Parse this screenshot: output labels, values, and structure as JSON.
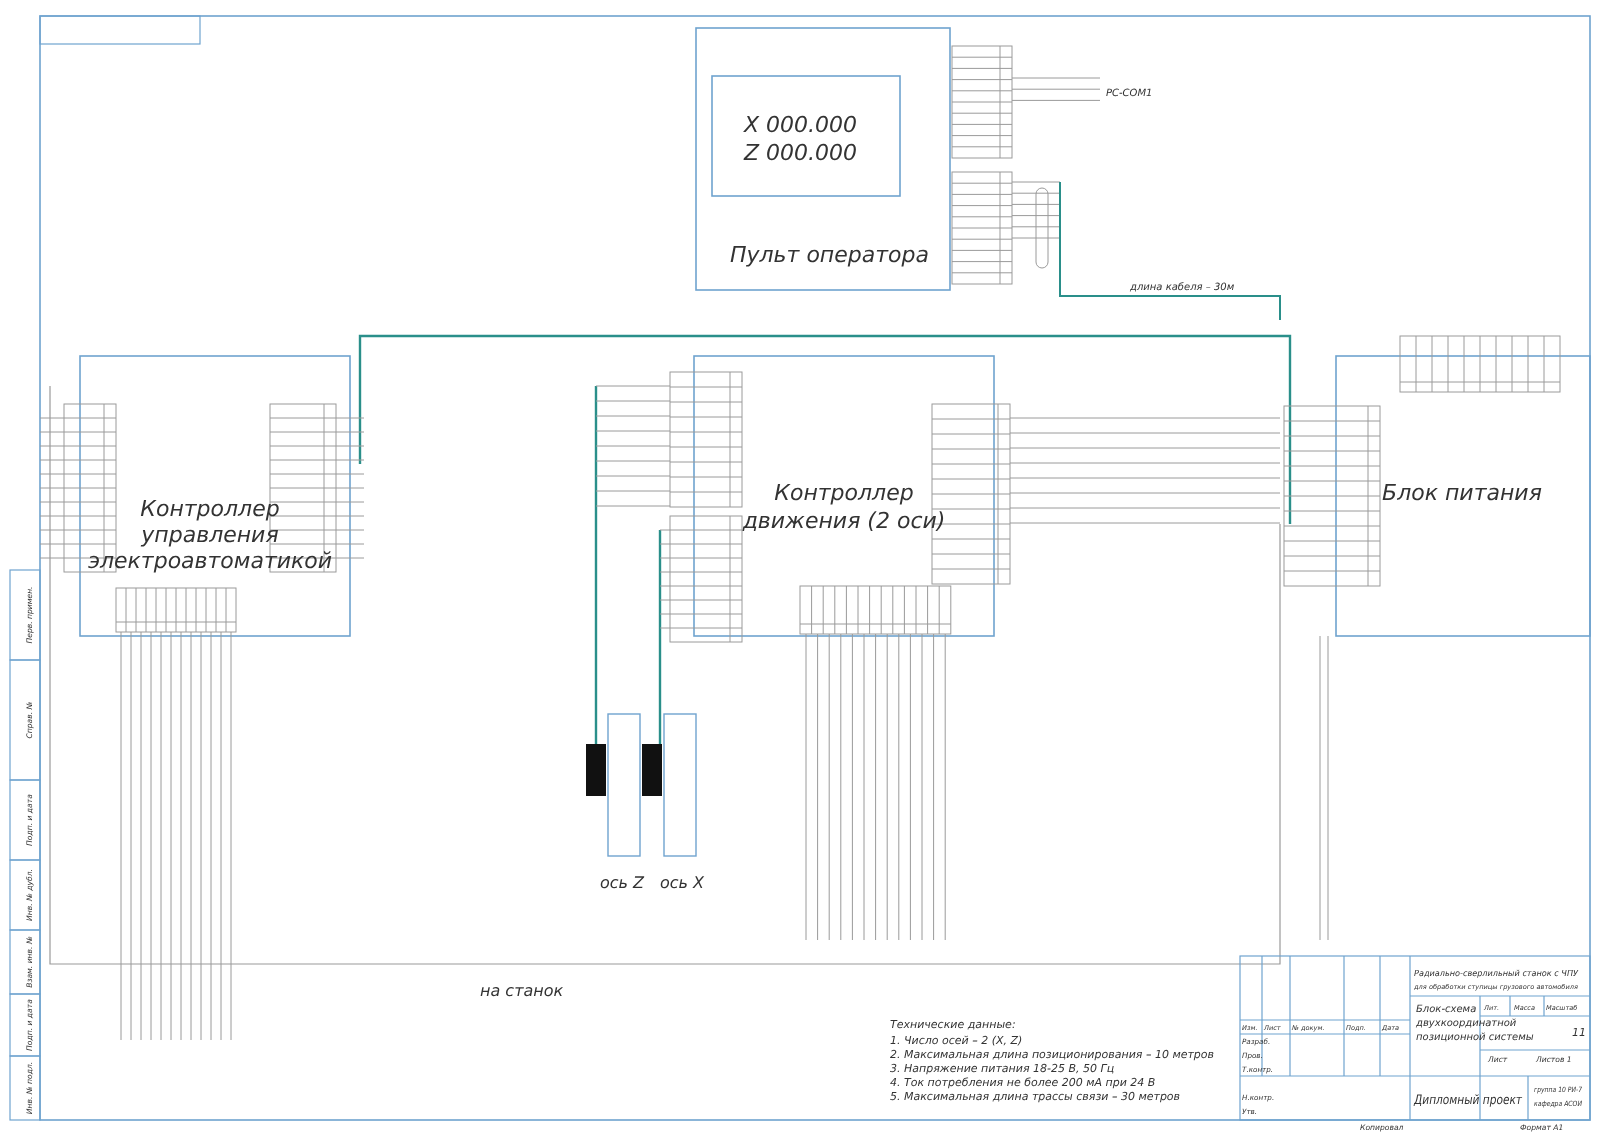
{
  "operator_panel": {
    "display_lines": [
      "X 000.000",
      "Z 000.000"
    ],
    "title": "Пульт оператора",
    "com_label": "РС-СОМ1",
    "cable_note": "длина кабеля – 30м"
  },
  "blocks": [
    {
      "kind": "logic",
      "title_lines": [
        "Контроллер",
        "управления",
        "электроавтоматикой"
      ]
    },
    {
      "kind": "motion",
      "title_lines": [
        "Контроллер",
        "движения (2 оси)"
      ]
    },
    {
      "kind": "power",
      "title_lines": [
        "Блок питания"
      ]
    }
  ],
  "axes": [
    {
      "label": "ось Z"
    },
    {
      "label": "ось X"
    }
  ],
  "machine_label": "на станок",
  "tech_notes": {
    "heading": "Технические данные:",
    "items": [
      "1. Число осей – 2 (X, Z)",
      "2. Максимальная длина позиционирования – 10 метров",
      "3. Напряжение питания 18-25 В, 50 Гц",
      "4. Ток потребления не более 200 мА при 24 В",
      "5. Максимальная длина трассы связи – 30 метров"
    ]
  },
  "title_block": {
    "product_lines": [
      "Радиально-сверлильный станок с ЧПУ",
      "для обработки ступицы грузового автомобиля"
    ],
    "document_lines": [
      "Блок-схема",
      "двухкоординатной",
      "позиционной системы"
    ],
    "project": "Дипломный проект",
    "group_lines": [
      "группа 10 РИ-7",
      "кафедра АСОИ"
    ],
    "header_cells": [
      "Изм.",
      "Лист",
      "№ докум.",
      "Подп.",
      "Дата"
    ],
    "role_cells": [
      "Разраб.",
      "Пров.",
      "Т.контр.",
      "Н.контр.",
      "Утв."
    ],
    "info_cells": [
      "Лит.",
      "Масса",
      "Масштаб"
    ],
    "scale": "11",
    "sheet_cells": [
      "Лист",
      "Листов 1"
    ],
    "footer_cells": [
      "Копировал",
      "Формат A1"
    ]
  },
  "margin_stamps": [
    "Перв. примен.",
    "Справ. №",
    "Подп. и дата",
    "Инв. № дубл.",
    "Взам. инв. №",
    "Подп. и дата",
    "Инв. № подл."
  ]
}
